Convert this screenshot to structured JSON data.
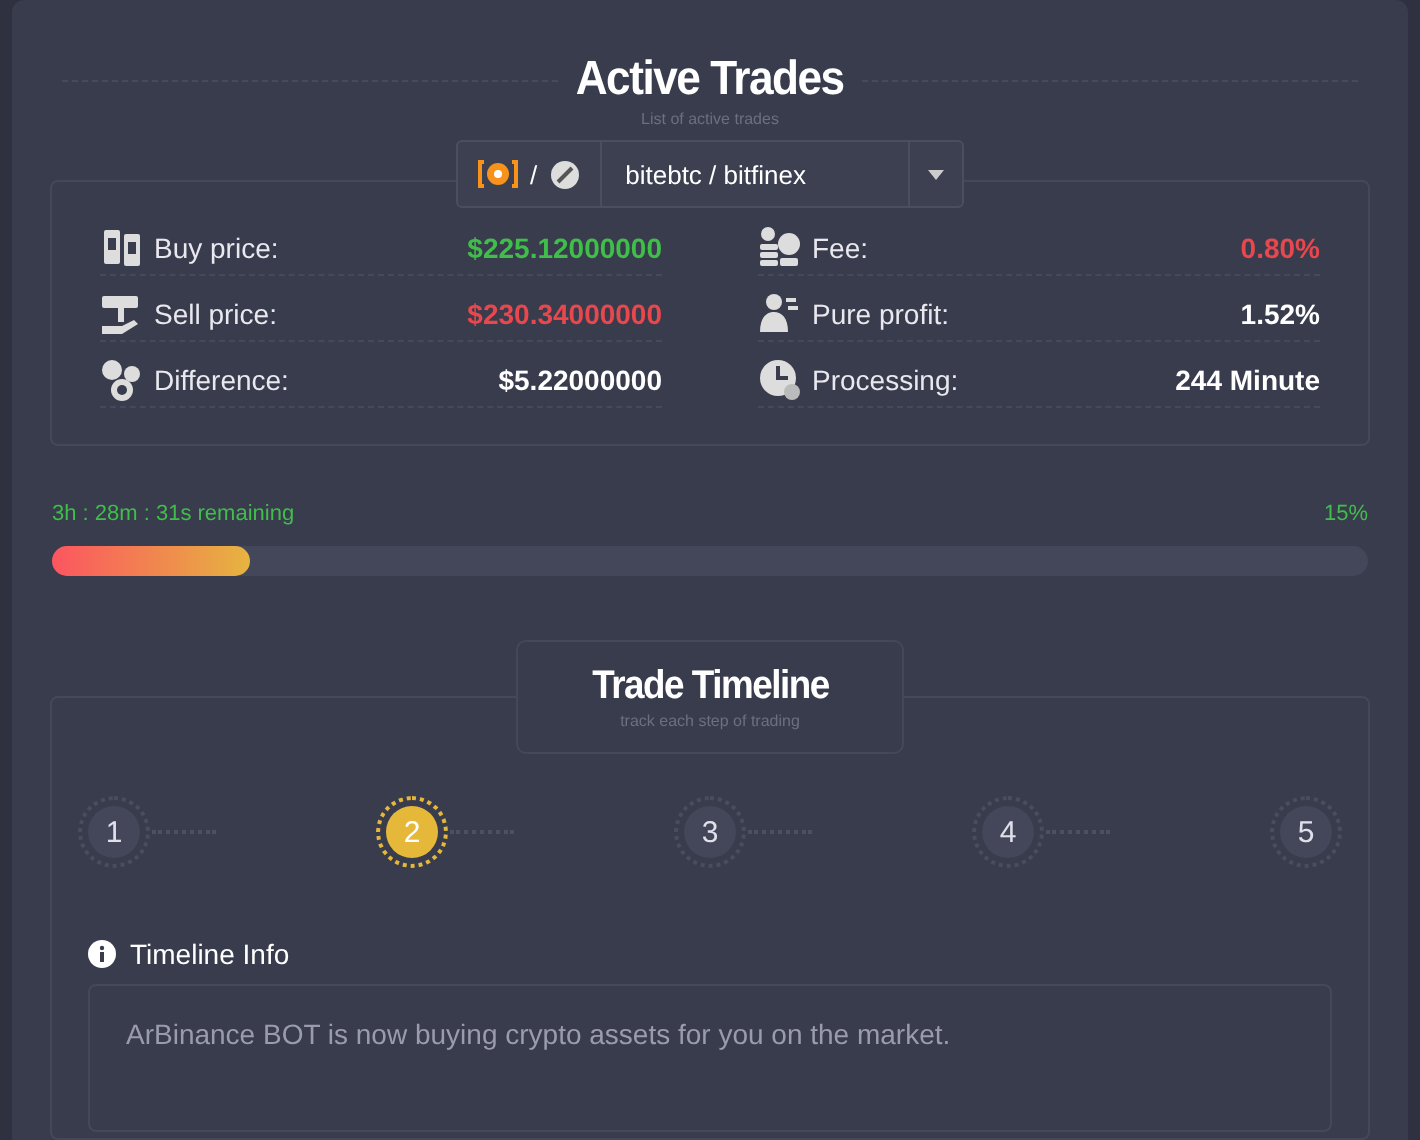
{
  "header": {
    "title": "Active Trades",
    "subtitle": "List of active trades"
  },
  "pair_select": {
    "separator": "/",
    "value": "bitebtc / bitfinex"
  },
  "stats": [
    {
      "label": "Buy price:",
      "value": "$225.12000000",
      "color": "#3fbf4a"
    },
    {
      "label": "Fee:",
      "value": "0.80%",
      "color": "#e8474d"
    },
    {
      "label": "Sell price:",
      "value": "$230.34000000",
      "color": "#e8474d"
    },
    {
      "label": "Pure profit:",
      "value": "1.52%",
      "color": "#ffffff"
    },
    {
      "label": "Difference:",
      "value": "$5.22000000",
      "color": "#ffffff"
    },
    {
      "label": "Processing:",
      "value": "244 Minute",
      "color": "#ffffff"
    }
  ],
  "progress": {
    "remaining": "3h : 28m : 31s remaining",
    "percent": "15%",
    "level": 0.15
  },
  "timeline": {
    "title": "Trade Timeline",
    "subtitle": "track each step of trading",
    "steps": [
      {
        "label": "1",
        "selected": false
      },
      {
        "label": "2",
        "selected": true
      },
      {
        "label": "3",
        "selected": false
      },
      {
        "label": "4",
        "selected": false
      },
      {
        "label": "5",
        "selected": false
      }
    ],
    "info_title": "Timeline Info",
    "info_text": "ArBinance BOT is now buying crypto assets for you on the market."
  }
}
